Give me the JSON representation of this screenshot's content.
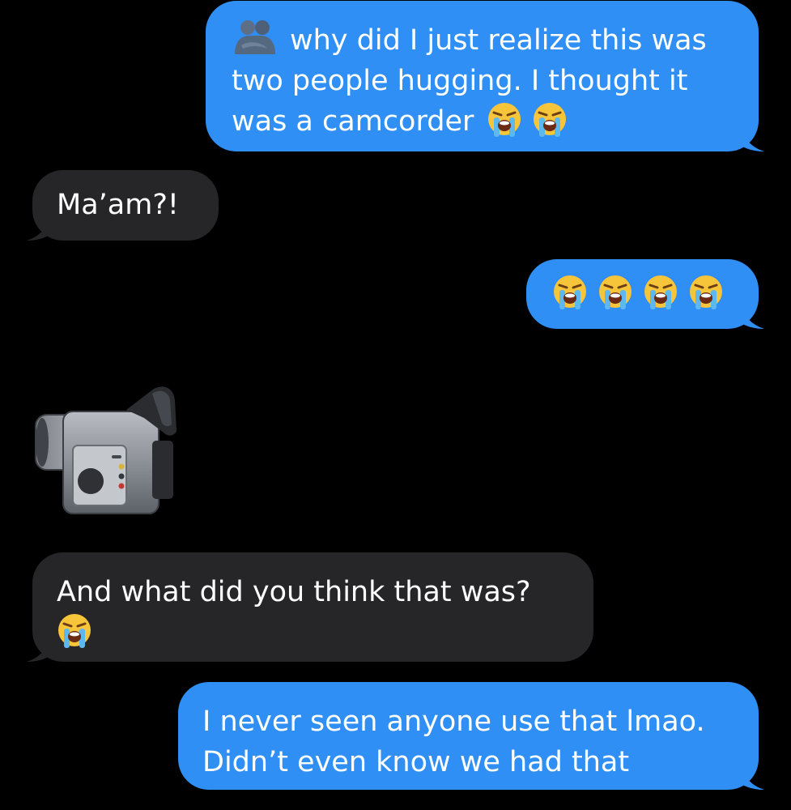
{
  "messages": [
    {
      "direction": "sent",
      "lines": [
        "why did I just realize this was",
        "two people hugging. I thought it",
        "was a camcorder"
      ],
      "leading_icon": "people-hugging-icon",
      "trailing_icons": [
        "loudly-crying-face-icon",
        "loudly-crying-face-icon"
      ]
    },
    {
      "direction": "received",
      "text": "Ma’am?!"
    },
    {
      "direction": "sent",
      "icons": [
        "loudly-crying-face-icon",
        "loudly-crying-face-icon",
        "loudly-crying-face-icon",
        "loudly-crying-face-icon"
      ]
    },
    {
      "direction": "received",
      "icon": "video-camera-icon"
    },
    {
      "direction": "received",
      "text": "And what did you think that was?",
      "trailing_icons": [
        "loudly-crying-face-icon"
      ]
    },
    {
      "direction": "sent",
      "lines": [
        "I never seen anyone use that lmao.",
        "Didn’t even know we had that"
      ]
    }
  ],
  "colors": {
    "background": "#000000",
    "sent_bubble": "#2f8ff5",
    "received_bubble": "#262628",
    "text": "#ffffff"
  }
}
